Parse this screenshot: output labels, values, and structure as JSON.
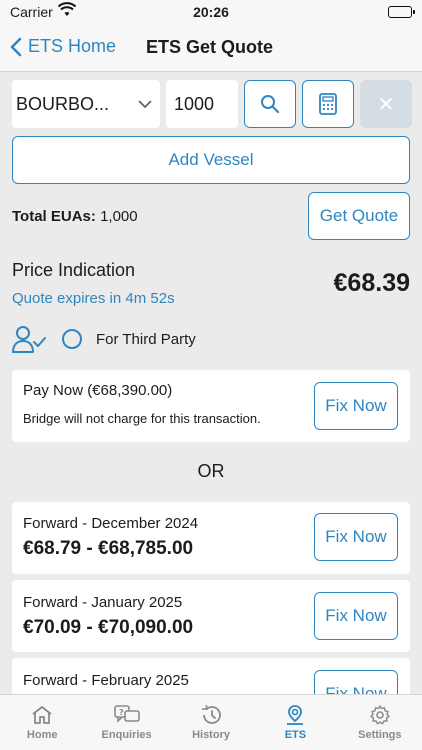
{
  "status_bar": {
    "carrier": "Carrier",
    "time": "20:26"
  },
  "nav": {
    "back_label": "ETS Home",
    "title": "ETS Get Quote"
  },
  "form": {
    "vessel_select": "BOURBO...",
    "quantity": "1000",
    "add_vessel_label": "Add Vessel",
    "total_euas_label": "Total EUAs:",
    "total_euas_value": "1,000",
    "get_quote_label": "Get Quote"
  },
  "price": {
    "label": "Price Indication",
    "expiry": "Quote expires in 4m 52s",
    "value": "€68.39"
  },
  "third_party": {
    "label": "For Third Party",
    "selected": false
  },
  "pay_now": {
    "title": "Pay Now (€68,390.00)",
    "note": "Bridge will not charge for this transaction.",
    "button": "Fix Now"
  },
  "or_label": "OR",
  "forwards": [
    {
      "title": "Forward - December 2024",
      "amount": "€68.79 - €68,785.00",
      "button": "Fix Now"
    },
    {
      "title": "Forward - January 2025",
      "amount": "€70.09 - €70,090.00",
      "button": "Fix Now"
    },
    {
      "title": "Forward - February 2025",
      "amount": "",
      "button": "Fix Now"
    }
  ],
  "tabs": [
    {
      "label": "Home",
      "icon": "home-icon",
      "active": false
    },
    {
      "label": "Enquiries",
      "icon": "enquiries-icon",
      "active": false
    },
    {
      "label": "History",
      "icon": "history-icon",
      "active": false
    },
    {
      "label": "ETS",
      "icon": "ets-icon",
      "active": true
    },
    {
      "label": "Settings",
      "icon": "settings-icon",
      "active": false
    }
  ],
  "colors": {
    "accent": "#2e86c1",
    "background": "#ebebeb",
    "inactive": "#8a8a8e"
  }
}
